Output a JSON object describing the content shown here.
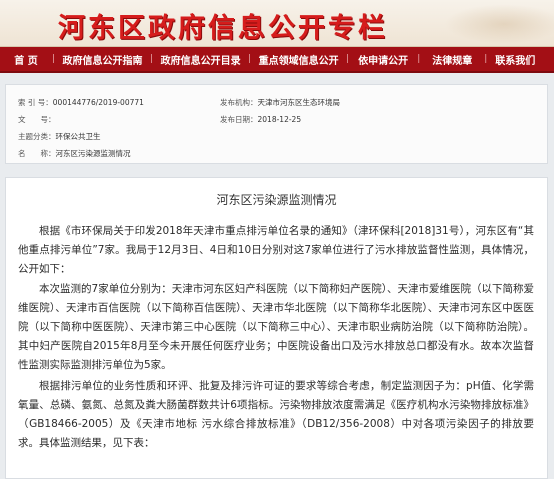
{
  "banner": {
    "title": "河东区政府信息公开专栏"
  },
  "nav": [
    "首 页",
    "政府信息公开指南",
    "政府信息公开目录",
    "重点领域信息公开",
    "依申请公开",
    "法律规章",
    "联系我们"
  ],
  "meta": {
    "index_label": "索 引 号：",
    "index_value": "000144776/2019-00771",
    "publisher_label": "发布机构：",
    "publisher_value": "天津市河东区生态环境局",
    "docno_label": "文　　号：",
    "docno_value": "",
    "date_label": "发布日期：",
    "date_value": "2018-12-25",
    "topic_label": "主题分类：",
    "topic_value": "环保公共卫生",
    "name_label": "名　　称：",
    "name_value": "河东区污染源监测情况"
  },
  "article": {
    "title": "河东区污染源监测情况",
    "p1": "根据《市环保局关于印发2018年天津市重点排污单位名录的通知》（津环保科[2018]31号），河东区有“其他重点排污单位”7家。我局于12月3日、4日和10日分别对这7家单位进行了污水排放监督性监测，具体情况，公开如下：",
    "p2": "本次监测的7家单位分别为：天津市河东区妇产科医院（以下简称妇产医院）、天津市爱维医院（以下简称爱维医院）、天津市百信医院（以下简称百信医院）、天津市华北医院（以下简称华北医院）、天津市河东区中医医院（以下简称中医医院）、天津市第三中心医院（以下简称三中心）、天津市职业病防治院（以下简称防治院）。其中妇产医院自2015年8月至今未开展任何医疗业务；中医院设备出口及污水排放总口都没有水。故本次监督性监测实际监测排污单位为5家。",
    "p3": "根据排污单位的业务性质和环评、批复及排污许可证的要求等综合考虑，制定监测因子为：pH值、化学需氧量、总磷、氨氮、总氮及粪大肠菌群数共计6项指标。污染物排放浓度需满足《医疗机构水污染物排放标准》（GB18466-2005）及《天津市地标 污水综合排放标准》（DB12/356-2008）中对各项污染因子的排放要求。具体监测结果，见下表："
  }
}
